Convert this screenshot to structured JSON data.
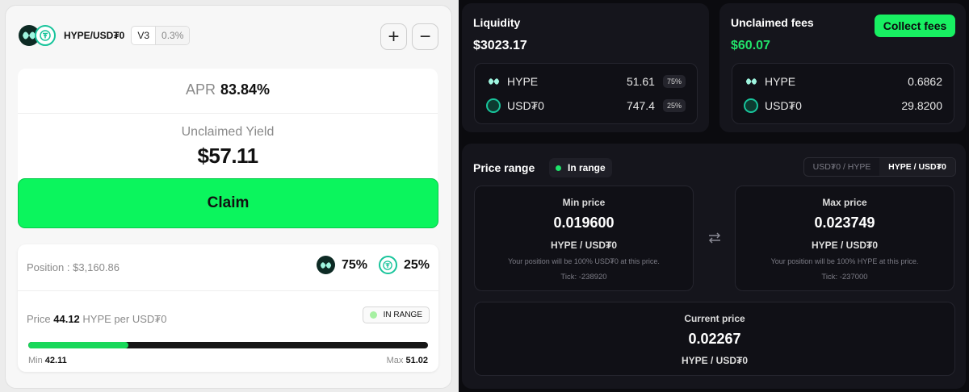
{
  "left": {
    "pair": "HYPE/USD₮0",
    "version": "V3",
    "fee": "0.3%",
    "plus_icon_label": "+",
    "minus_icon_label": "−",
    "apr_label": "APR",
    "apr_value": "83.84%",
    "unclaimed_label": "Unclaimed Yield",
    "unclaimed_value": "$57.11",
    "claim_label": "Claim",
    "position_label": "Position : $3,160.86",
    "hype_pct": "75%",
    "usdt_pct": "25%",
    "price_prefix": "Price",
    "price_value": "44.12",
    "price_suffix": "HYPE per USD₮0",
    "range_badge": "IN RANGE",
    "range_progress": 0.25,
    "min_label": "Min",
    "min_value": "42.11",
    "max_label": "Max",
    "max_value": "51.02"
  },
  "liquidity": {
    "title": "Liquidity",
    "total": "$3023.17",
    "tokens": [
      {
        "name": "HYPE",
        "amount": "51.61",
        "pct": "75%"
      },
      {
        "name": "USD₮0",
        "amount": "747.4",
        "pct": "25%"
      }
    ]
  },
  "fees": {
    "title": "Unclaimed fees",
    "total": "$60.07",
    "collect_label": "Collect fees",
    "tokens": [
      {
        "name": "HYPE",
        "amount": "0.6862"
      },
      {
        "name": "USD₮0",
        "amount": "29.8200"
      }
    ]
  },
  "range": {
    "title": "Price range",
    "status": "In range",
    "toggle_a": "USD₮0 / HYPE",
    "toggle_b": "HYPE / USD₮0",
    "min": {
      "label": "Min price",
      "value": "0.019600",
      "unit": "HYPE / USD₮0",
      "note": "Your position will be 100% USD₮0 at this price.",
      "tick": "Tick: -238920"
    },
    "max": {
      "label": "Max price",
      "value": "0.023749",
      "unit": "HYPE / USD₮0",
      "note": "Your position will be 100% HYPE at this price.",
      "tick": "Tick: -237000"
    },
    "current": {
      "label": "Current price",
      "value": "0.02267",
      "unit": "HYPE / USD₮0"
    }
  },
  "colors": {
    "accent_green": "#0bf55d",
    "hype_teal": "#18c49b",
    "dark_bg": "#0b0b0f"
  }
}
